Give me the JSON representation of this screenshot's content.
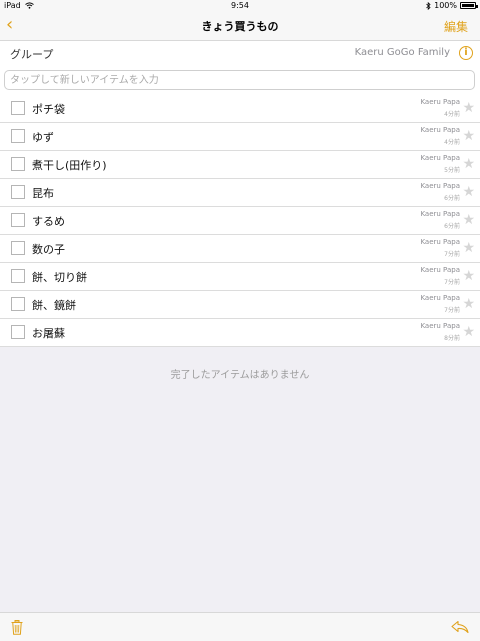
{
  "statusbar": {
    "device": "iPad",
    "time": "9:54",
    "battery": "100%"
  },
  "nav": {
    "back_label": "‹",
    "title": "きょう買うもの",
    "edit_label": "編集"
  },
  "group": {
    "label": "グループ",
    "value": "Kaeru GoGo Family",
    "info": "i"
  },
  "input": {
    "placeholder": "タップして新しいアイテムを入力"
  },
  "items": [
    {
      "name": "ポチ袋",
      "user": "Kaeru Papa",
      "time": "4分前"
    },
    {
      "name": "ゆず",
      "user": "Kaeru Papa",
      "time": "4分前"
    },
    {
      "name": "煮干し(田作り)",
      "user": "Kaeru Papa",
      "time": "5分前"
    },
    {
      "name": "昆布",
      "user": "Kaeru Papa",
      "time": "6分前"
    },
    {
      "name": "するめ",
      "user": "Kaeru Papa",
      "time": "6分前"
    },
    {
      "name": "数の子",
      "user": "Kaeru Papa",
      "time": "7分前"
    },
    {
      "name": "餅、切り餅",
      "user": "Kaeru Papa",
      "time": "7分前"
    },
    {
      "name": "餅、鏡餅",
      "user": "Kaeru Papa",
      "time": "7分前"
    },
    {
      "name": "お屠蘇",
      "user": "Kaeru Papa",
      "time": "8分前"
    }
  ],
  "empty_message": "完了したアイテムはありません",
  "colors": {
    "accent": "#e0a21b",
    "background": "#f0eff4"
  },
  "icons": {
    "trash": "trash-icon",
    "reply": "reply-icon",
    "star": "star-icon",
    "wifi": "wifi-icon",
    "bluetooth": "bluetooth-icon"
  }
}
